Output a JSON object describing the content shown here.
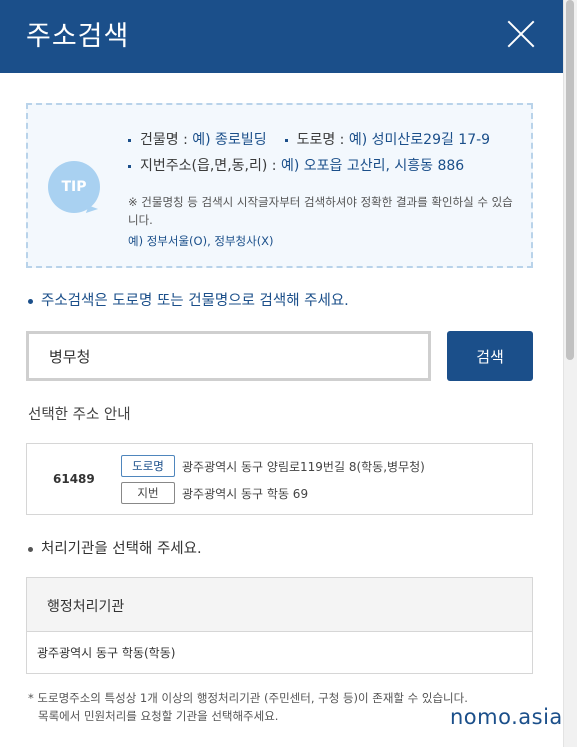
{
  "header": {
    "title": "주소검색",
    "close_icon": "close-icon"
  },
  "tip": {
    "badge": "TIP",
    "line1_label1": "건물명 : ",
    "line1_value1": "예) 종로빌딩",
    "line1_label2": "도로명 : ",
    "line1_value2": "예) 성미산로29길 17-9",
    "line2_label": "지번주소(읍,면,동,리) : ",
    "line2_value": "예) 오포읍 고산리, 시흥동 886",
    "note": "※ 건물명칭 등 검색시 시작글자부터 검색하셔야 정확한 결과를 확인하실 수 있습니다.",
    "example": "예) 정부서울(O), 정부청사(X)"
  },
  "search": {
    "guide": "주소검색은 도로명 또는 건물명으로 검색해 주세요.",
    "value": "병무청",
    "placeholder": "",
    "button_label": "검색"
  },
  "selected": {
    "section_label": "선택한 주소 안내",
    "zipcode": "61489",
    "road_tag": "도로명",
    "road_address": "광주광역시 동구 양림로119번길 8(학동,병무청)",
    "jibun_tag": "지번",
    "jibun_address": "광주광역시 동구 학동 69"
  },
  "agency": {
    "guide": "처리기관을 선택해 주세요.",
    "header": "행정처리기관",
    "rows": [
      "광주광역시 동구 학동(학동)"
    ]
  },
  "footnote": {
    "line1": "* 도로명주소의 특성상 1개 이상의 행정처리기관 (주민센터, 구청 등)이 존재할 수 있습니다.",
    "line2": "목록에서 민원처리를 요청할 기관을 선택해주세요."
  },
  "watermark": "nomo.asia",
  "colors": {
    "brand": "#1b4f8a",
    "tip_background": "#f3f8fd",
    "tip_border": "#b9d3ea",
    "tip_badge": "#a9d1f1"
  }
}
